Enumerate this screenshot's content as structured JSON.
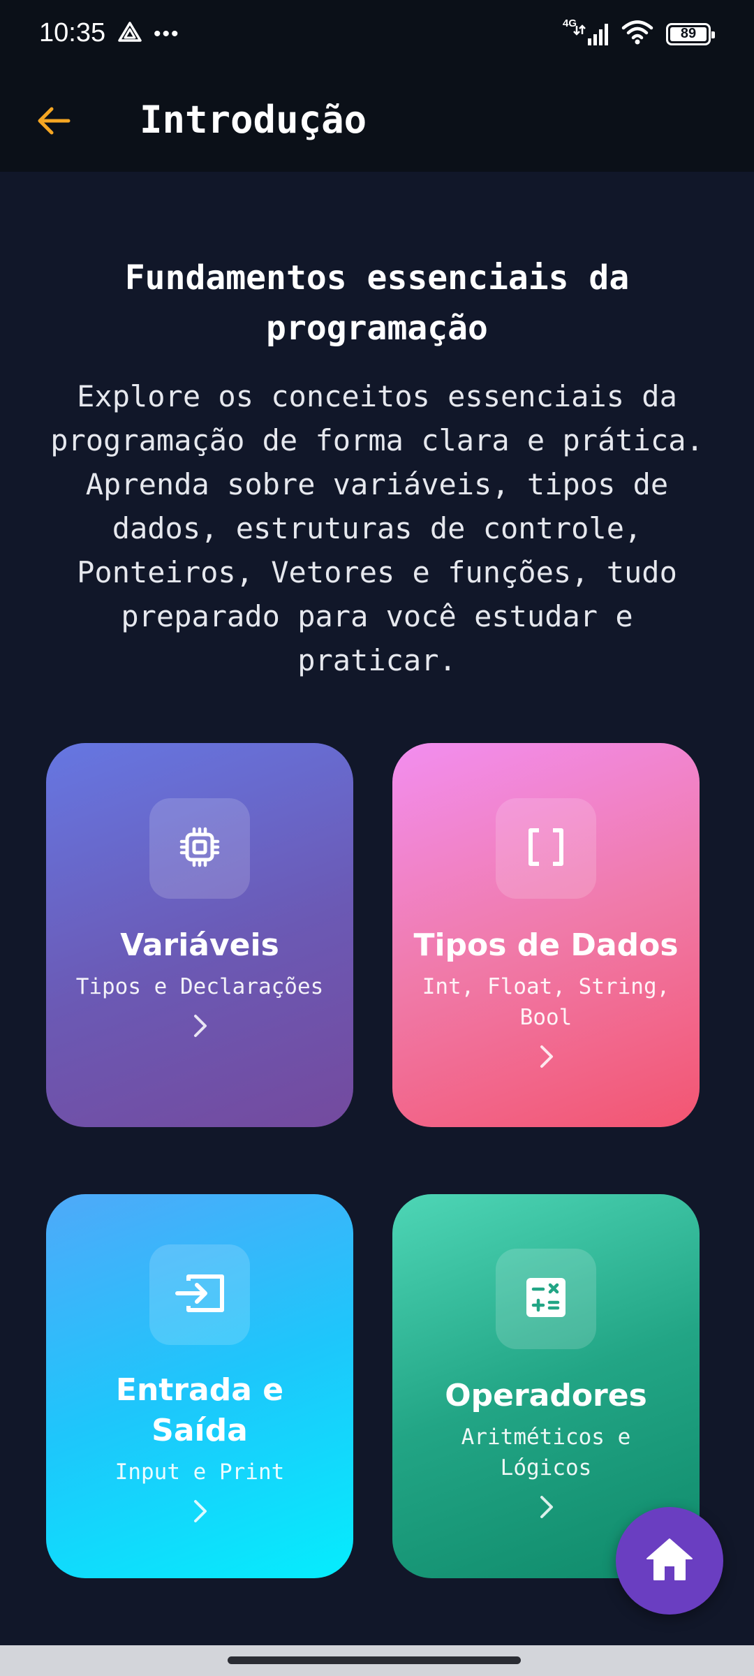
{
  "status_bar": {
    "time": "10:35",
    "network": "4G",
    "battery": "89",
    "battery_level_percent": 89
  },
  "app_bar": {
    "title": "Introdução",
    "back_icon": "arrow-left-icon",
    "accent_color": "#f5a623"
  },
  "intro": {
    "heading": "Fundamentos essenciais da programação",
    "description": "Explore os conceitos essenciais da programação de forma clara e prática. Aprenda sobre variáveis, tipos de dados, estruturas de controle, Ponteiros, Vetores e funções, tudo preparado para você estudar e praticar."
  },
  "cards": [
    {
      "title": "Variáveis",
      "subtitle": "Tipos e Declarações",
      "icon": "chip-icon"
    },
    {
      "title": "Tipos de Dados",
      "subtitle": "Int, Float, String, Bool",
      "icon": "brackets-icon"
    },
    {
      "title": "Entrada e Saída",
      "subtitle": "Input e Print",
      "icon": "input-icon"
    },
    {
      "title": "Operadores",
      "subtitle": "Aritméticos e Lógicos",
      "icon": "calculator-icon"
    }
  ],
  "fab": {
    "icon": "home-icon",
    "color": "#6a3ec1"
  }
}
